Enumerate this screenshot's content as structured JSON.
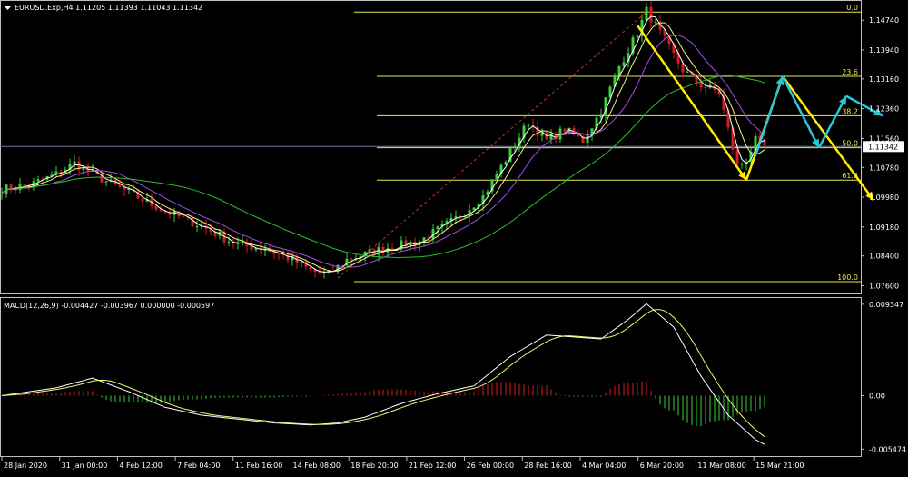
{
  "header": {
    "symbol_line": "EURUSD.Exp,H4  1.11205 1.11393 1.11043 1.11342",
    "macd_line": "MACD(12,26,9) -0.004427 -0.003967 0.000000 -0.000597"
  },
  "colors": {
    "background": "#000000",
    "border": "#c0c0c0",
    "fib": "#e8e84a",
    "bull": "#3ccf3c",
    "bear": "#d21e1e",
    "ma_fast": "#ffffff",
    "ma_mid": "#f5f57a",
    "ma_slow": "#a24de6",
    "ma_long": "#2bbd2b",
    "arrow_yellow": "#ffee00",
    "arrow_cyan": "#29c7d8",
    "trend_dashed": "#c0392b"
  },
  "chart_data": [
    {
      "type": "candlestick",
      "title": "EURUSD.Exp,H4",
      "ylim": [
        1.0744,
        1.1521
      ],
      "price_ticks": [
        "1.14740",
        "1.13940",
        "1.13160",
        "1.12360",
        "1.11560",
        "1.10780",
        "1.09980",
        "1.09180",
        "1.08400",
        "1.07600"
      ],
      "current_price": "1.11342",
      "x_ticks": [
        "28 Jan 2020",
        "31 Jan 00:00",
        "4 Feb 12:00",
        "7 Feb 04:00",
        "11 Feb 16:00",
        "14 Feb 08:00",
        "18 Feb 20:00",
        "21 Feb 12:00",
        "26 Feb 00:00",
        "28 Feb 16:00",
        "4 Mar 04:00",
        "6 Mar 20:00",
        "11 Mar 08:00",
        "15 Mar 21:00"
      ],
      "price_path": [
        [
          0,
          1.102
        ],
        [
          6,
          1.103
        ],
        [
          12,
          1.106
        ],
        [
          16,
          1.109
        ],
        [
          20,
          1.106
        ],
        [
          28,
          1.101
        ],
        [
          36,
          1.096
        ],
        [
          44,
          1.092
        ],
        [
          52,
          1.087
        ],
        [
          58,
          1.086
        ],
        [
          64,
          1.083
        ],
        [
          68,
          1.08
        ],
        [
          72,
          1.079
        ],
        [
          76,
          1.083
        ],
        [
          84,
          1.086
        ],
        [
          92,
          1.088
        ],
        [
          100,
          1.094
        ],
        [
          106,
          1.1
        ],
        [
          110,
          1.108
        ],
        [
          116,
          1.12
        ],
        [
          120,
          1.115
        ],
        [
          124,
          1.118
        ],
        [
          128,
          1.115
        ],
        [
          132,
          1.123
        ],
        [
          136,
          1.135
        ],
        [
          140,
          1.144
        ],
        [
          142,
          1.15
        ],
        [
          146,
          1.142
        ],
        [
          150,
          1.134
        ],
        [
          154,
          1.13
        ],
        [
          158,
          1.128
        ],
        [
          160,
          1.118
        ],
        [
          162,
          1.108
        ],
        [
          164,
          1.11
        ],
        [
          166,
          1.115
        ],
        [
          168,
          1.1134
        ]
      ],
      "fib_levels": [
        {
          "label": "0.0",
          "price": 1.1496
        },
        {
          "label": "23.6",
          "price": 1.1323
        },
        {
          "label": "38.2",
          "price": 1.1217
        },
        {
          "label": "50.0",
          "price": 1.1131
        },
        {
          "label": "61.8",
          "price": 1.1044
        },
        {
          "label": "100.0",
          "price": 1.0771
        }
      ],
      "moving_averages": [
        {
          "color": "#ffffff",
          "smoothing": 3
        },
        {
          "color": "#f5f57a",
          "smoothing": 6
        },
        {
          "color": "#a24de6",
          "smoothing": 12
        },
        {
          "color": "#2bbd2b",
          "smoothing": 34
        }
      ],
      "projection_yellow": [
        [
          140,
          1.146
        ],
        [
          164,
          1.1044
        ],
        [
          172,
          1.1323
        ],
        [
          192,
          1.099
        ]
      ],
      "projection_cyan": [
        [
          166,
          1.111
        ],
        [
          172,
          1.1323
        ],
        [
          180,
          1.1131
        ],
        [
          186,
          1.127
        ],
        [
          194,
          1.1217
        ]
      ]
    },
    {
      "type": "bar",
      "title": "MACD(12,26,9)",
      "ylim": [
        -0.006,
        0.0098
      ],
      "y_ticks": [
        "0.009347",
        "0.00",
        "-0.005474"
      ],
      "macd_path": [
        [
          0,
          0.0
        ],
        [
          12,
          0.0008
        ],
        [
          20,
          0.0018
        ],
        [
          28,
          0.0004
        ],
        [
          36,
          -0.0012
        ],
        [
          44,
          -0.002
        ],
        [
          52,
          -0.0024
        ],
        [
          60,
          -0.0028
        ],
        [
          68,
          -0.003
        ],
        [
          74,
          -0.0028
        ],
        [
          80,
          -0.0022
        ],
        [
          88,
          -0.0008
        ],
        [
          96,
          0.0002
        ],
        [
          104,
          0.001
        ],
        [
          112,
          0.004
        ],
        [
          120,
          0.0062
        ],
        [
          126,
          0.006
        ],
        [
          132,
          0.0058
        ],
        [
          138,
          0.0078
        ],
        [
          142,
          0.0094
        ],
        [
          148,
          0.007
        ],
        [
          154,
          0.002
        ],
        [
          160,
          -0.002
        ],
        [
          166,
          -0.0045
        ],
        [
          170,
          -0.0055
        ]
      ],
      "signal_smoothing": 6
    }
  ]
}
